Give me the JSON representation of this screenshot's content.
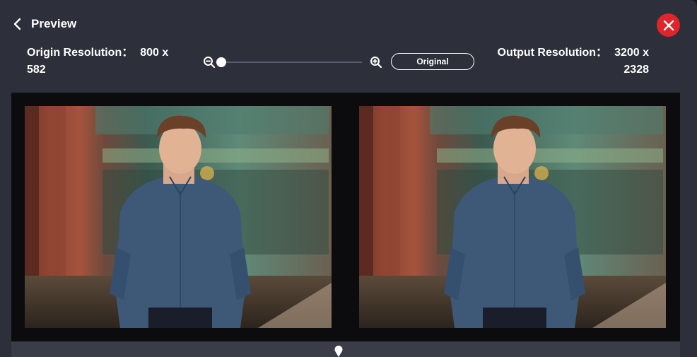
{
  "header": {
    "title": "Preview"
  },
  "origin": {
    "label": "Origin Resolution：",
    "width": "800 x",
    "height": "582"
  },
  "output": {
    "label": "Output Resolution：",
    "width": "3200 x",
    "height": "2328"
  },
  "zoom": {
    "original_label": "Original",
    "level": 0
  },
  "icons": {
    "back": "chevron-left-icon",
    "close": "close-icon",
    "zoom_out": "zoom-out-icon",
    "zoom_in": "zoom-in-icon",
    "pin": "map-pin-icon"
  },
  "colors": {
    "close_bg": "#e0242b",
    "dialog_bg": "#2d2f3a",
    "compare_bg": "#0c0c0f"
  }
}
